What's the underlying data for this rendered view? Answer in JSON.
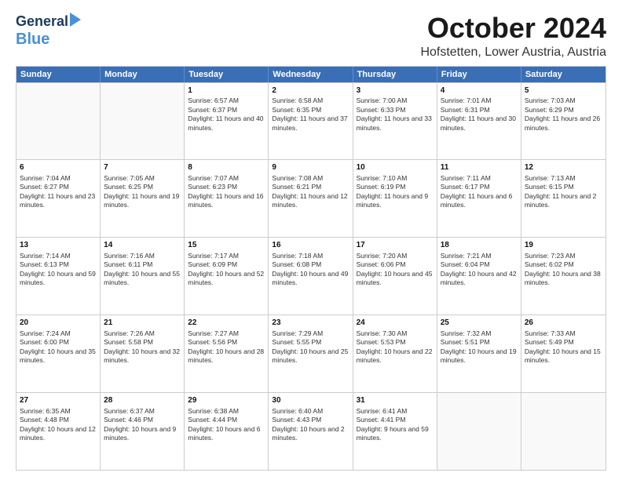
{
  "header": {
    "logo_line1": "General",
    "logo_line2": "Blue",
    "month": "October 2024",
    "location": "Hofstetten, Lower Austria, Austria"
  },
  "weekdays": [
    "Sunday",
    "Monday",
    "Tuesday",
    "Wednesday",
    "Thursday",
    "Friday",
    "Saturday"
  ],
  "rows": [
    [
      {
        "day": "",
        "empty": true
      },
      {
        "day": "",
        "empty": true
      },
      {
        "day": "1",
        "sunrise": "Sunrise: 6:57 AM",
        "sunset": "Sunset: 6:37 PM",
        "daylight": "Daylight: 11 hours and 40 minutes."
      },
      {
        "day": "2",
        "sunrise": "Sunrise: 6:58 AM",
        "sunset": "Sunset: 6:35 PM",
        "daylight": "Daylight: 11 hours and 37 minutes."
      },
      {
        "day": "3",
        "sunrise": "Sunrise: 7:00 AM",
        "sunset": "Sunset: 6:33 PM",
        "daylight": "Daylight: 11 hours and 33 minutes."
      },
      {
        "day": "4",
        "sunrise": "Sunrise: 7:01 AM",
        "sunset": "Sunset: 6:31 PM",
        "daylight": "Daylight: 11 hours and 30 minutes."
      },
      {
        "day": "5",
        "sunrise": "Sunrise: 7:03 AM",
        "sunset": "Sunset: 6:29 PM",
        "daylight": "Daylight: 11 hours and 26 minutes."
      }
    ],
    [
      {
        "day": "6",
        "sunrise": "Sunrise: 7:04 AM",
        "sunset": "Sunset: 6:27 PM",
        "daylight": "Daylight: 11 hours and 23 minutes."
      },
      {
        "day": "7",
        "sunrise": "Sunrise: 7:05 AM",
        "sunset": "Sunset: 6:25 PM",
        "daylight": "Daylight: 11 hours and 19 minutes."
      },
      {
        "day": "8",
        "sunrise": "Sunrise: 7:07 AM",
        "sunset": "Sunset: 6:23 PM",
        "daylight": "Daylight: 11 hours and 16 minutes."
      },
      {
        "day": "9",
        "sunrise": "Sunrise: 7:08 AM",
        "sunset": "Sunset: 6:21 PM",
        "daylight": "Daylight: 11 hours and 12 minutes."
      },
      {
        "day": "10",
        "sunrise": "Sunrise: 7:10 AM",
        "sunset": "Sunset: 6:19 PM",
        "daylight": "Daylight: 11 hours and 9 minutes."
      },
      {
        "day": "11",
        "sunrise": "Sunrise: 7:11 AM",
        "sunset": "Sunset: 6:17 PM",
        "daylight": "Daylight: 11 hours and 6 minutes."
      },
      {
        "day": "12",
        "sunrise": "Sunrise: 7:13 AM",
        "sunset": "Sunset: 6:15 PM",
        "daylight": "Daylight: 11 hours and 2 minutes."
      }
    ],
    [
      {
        "day": "13",
        "sunrise": "Sunrise: 7:14 AM",
        "sunset": "Sunset: 6:13 PM",
        "daylight": "Daylight: 10 hours and 59 minutes."
      },
      {
        "day": "14",
        "sunrise": "Sunrise: 7:16 AM",
        "sunset": "Sunset: 6:11 PM",
        "daylight": "Daylight: 10 hours and 55 minutes."
      },
      {
        "day": "15",
        "sunrise": "Sunrise: 7:17 AM",
        "sunset": "Sunset: 6:09 PM",
        "daylight": "Daylight: 10 hours and 52 minutes."
      },
      {
        "day": "16",
        "sunrise": "Sunrise: 7:18 AM",
        "sunset": "Sunset: 6:08 PM",
        "daylight": "Daylight: 10 hours and 49 minutes."
      },
      {
        "day": "17",
        "sunrise": "Sunrise: 7:20 AM",
        "sunset": "Sunset: 6:06 PM",
        "daylight": "Daylight: 10 hours and 45 minutes."
      },
      {
        "day": "18",
        "sunrise": "Sunrise: 7:21 AM",
        "sunset": "Sunset: 6:04 PM",
        "daylight": "Daylight: 10 hours and 42 minutes."
      },
      {
        "day": "19",
        "sunrise": "Sunrise: 7:23 AM",
        "sunset": "Sunset: 6:02 PM",
        "daylight": "Daylight: 10 hours and 38 minutes."
      }
    ],
    [
      {
        "day": "20",
        "sunrise": "Sunrise: 7:24 AM",
        "sunset": "Sunset: 6:00 PM",
        "daylight": "Daylight: 10 hours and 35 minutes."
      },
      {
        "day": "21",
        "sunrise": "Sunrise: 7:26 AM",
        "sunset": "Sunset: 5:58 PM",
        "daylight": "Daylight: 10 hours and 32 minutes."
      },
      {
        "day": "22",
        "sunrise": "Sunrise: 7:27 AM",
        "sunset": "Sunset: 5:56 PM",
        "daylight": "Daylight: 10 hours and 28 minutes."
      },
      {
        "day": "23",
        "sunrise": "Sunrise: 7:29 AM",
        "sunset": "Sunset: 5:55 PM",
        "daylight": "Daylight: 10 hours and 25 minutes."
      },
      {
        "day": "24",
        "sunrise": "Sunrise: 7:30 AM",
        "sunset": "Sunset: 5:53 PM",
        "daylight": "Daylight: 10 hours and 22 minutes."
      },
      {
        "day": "25",
        "sunrise": "Sunrise: 7:32 AM",
        "sunset": "Sunset: 5:51 PM",
        "daylight": "Daylight: 10 hours and 19 minutes."
      },
      {
        "day": "26",
        "sunrise": "Sunrise: 7:33 AM",
        "sunset": "Sunset: 5:49 PM",
        "daylight": "Daylight: 10 hours and 15 minutes."
      }
    ],
    [
      {
        "day": "27",
        "sunrise": "Sunrise: 6:35 AM",
        "sunset": "Sunset: 4:48 PM",
        "daylight": "Daylight: 10 hours and 12 minutes."
      },
      {
        "day": "28",
        "sunrise": "Sunrise: 6:37 AM",
        "sunset": "Sunset: 4:46 PM",
        "daylight": "Daylight: 10 hours and 9 minutes."
      },
      {
        "day": "29",
        "sunrise": "Sunrise: 6:38 AM",
        "sunset": "Sunset: 4:44 PM",
        "daylight": "Daylight: 10 hours and 6 minutes."
      },
      {
        "day": "30",
        "sunrise": "Sunrise: 6:40 AM",
        "sunset": "Sunset: 4:43 PM",
        "daylight": "Daylight: 10 hours and 2 minutes."
      },
      {
        "day": "31",
        "sunrise": "Sunrise: 6:41 AM",
        "sunset": "Sunset: 4:41 PM",
        "daylight": "Daylight: 9 hours and 59 minutes."
      },
      {
        "day": "",
        "empty": true
      },
      {
        "day": "",
        "empty": true
      }
    ]
  ]
}
